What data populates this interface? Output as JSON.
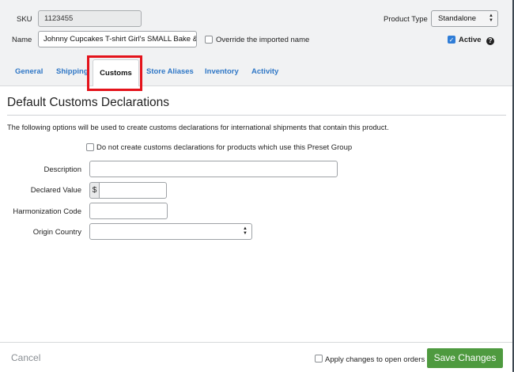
{
  "header": {
    "sku_label": "SKU",
    "sku_value": "1123455",
    "name_label": "Name",
    "name_value": "Johnny Cupcakes T-shirt Girl's SMALL Bake & Ta",
    "override_label": "Override the imported name",
    "override_checked": false,
    "product_type_label": "Product Type",
    "product_type_value": "Standalone",
    "active_label": "Active",
    "active_checked": true,
    "help_glyph": "?"
  },
  "tabs": [
    {
      "label": "General",
      "active": false
    },
    {
      "label": "Shipping",
      "active": false
    },
    {
      "label": "Customs",
      "active": true
    },
    {
      "label": "Store Aliases",
      "active": false
    },
    {
      "label": "Inventory",
      "active": false
    },
    {
      "label": "Activity",
      "active": false
    }
  ],
  "main": {
    "section_title": "Default Customs Declarations",
    "info_text": "The following options will be used to create customs declarations for international shipments that contain this product.",
    "no_declarations_label": "Do not create customs declarations for products which use this Preset Group",
    "fields": {
      "description_label": "Description",
      "description_value": "",
      "declared_value_label": "Declared Value",
      "currency_symbol": "$",
      "declared_value_value": "",
      "harmonization_label": "Harmonization Code",
      "harmonization_value": "",
      "origin_country_label": "Origin Country",
      "origin_country_value": ""
    }
  },
  "footer": {
    "cancel_label": "Cancel",
    "apply_label": "Apply changes to open orders",
    "save_label": "Save Changes"
  },
  "colors": {
    "tab_link": "#2f77c6",
    "highlight": "#e4131b",
    "save_button": "#4e9a3f",
    "checkbox_checked": "#2f7dd7"
  }
}
